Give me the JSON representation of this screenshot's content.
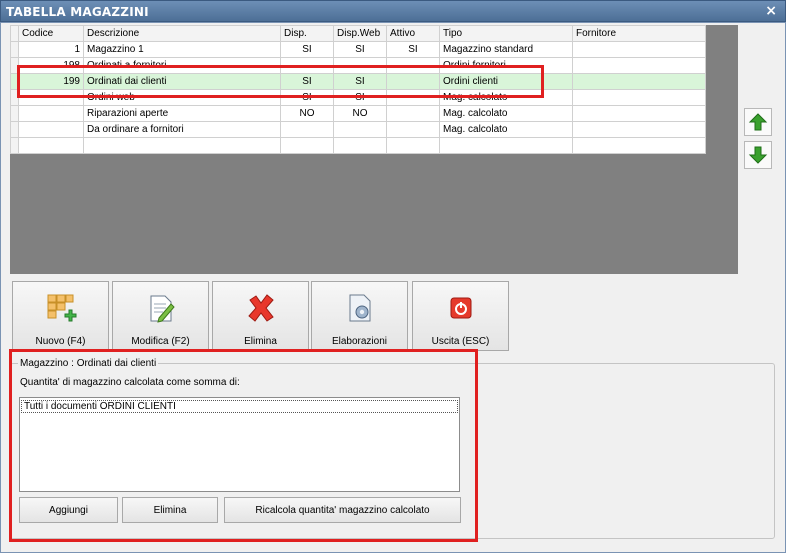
{
  "window": {
    "title": "TABELLA MAGAZZINI",
    "close_glyph": "×"
  },
  "grid": {
    "columns": [
      "Codice",
      "Descrizione",
      "Disp.",
      "Disp.Web",
      "Attivo",
      "Tipo",
      "Fornitore"
    ],
    "rows": [
      {
        "codice": "1",
        "descrizione": "Magazzino 1",
        "disp": "SI",
        "disp_web": "SI",
        "attivo": "SI",
        "tipo": "Magazzino standard",
        "fornitore": ""
      },
      {
        "codice": "198",
        "descrizione": "Ordinati a fornitori",
        "disp": "",
        "disp_web": "",
        "attivo": "",
        "tipo": "Ordini fornitori",
        "fornitore": ""
      },
      {
        "codice": "199",
        "descrizione": "Ordinati dai clienti",
        "disp": "SI",
        "disp_web": "SI",
        "attivo": "",
        "tipo": "Ordini clienti",
        "fornitore": ""
      },
      {
        "codice": "",
        "descrizione": "Ordini web",
        "disp": "SI",
        "disp_web": "SI",
        "attivo": "",
        "tipo": "Mag. calcolato",
        "fornitore": ""
      },
      {
        "codice": "",
        "descrizione": "Riparazioni aperte",
        "disp": "NO",
        "disp_web": "NO",
        "attivo": "",
        "tipo": "Mag. calcolato",
        "fornitore": ""
      },
      {
        "codice": "",
        "descrizione": "Da ordinare a fornitori",
        "disp": "",
        "disp_web": "",
        "attivo": "",
        "tipo": "Mag. calcolato",
        "fornitore": ""
      },
      {
        "codice": "",
        "descrizione": "",
        "disp": "",
        "disp_web": "",
        "attivo": "",
        "tipo": "",
        "fornitore": ""
      }
    ],
    "selected_row_index": 2,
    "selected_row_color": "#d9f5d9"
  },
  "side_buttons": {
    "up_icon": "arrow-up-icon",
    "down_icon": "arrow-down-icon",
    "color": "#3aa12e"
  },
  "toolbar": {
    "nuovo": "Nuovo (F4)",
    "modifica": "Modifica (F2)",
    "elimina": "Elimina",
    "elaborazioni": "Elaborazioni",
    "uscita": "Uscita (ESC)"
  },
  "detail": {
    "group_title": "Magazzino : Ordinati dai clienti",
    "sub_label": "Quantita' di magazzino calcolata come somma di:",
    "list_items": [
      "Tutti i documenti ORDINI CLIENTI"
    ],
    "buttons": {
      "aggiungi": "Aggiungi",
      "elimina": "Elimina",
      "ricalcola": "Ricalcola quantita' magazzino calcolato"
    }
  },
  "highlight_color": "#e02020"
}
